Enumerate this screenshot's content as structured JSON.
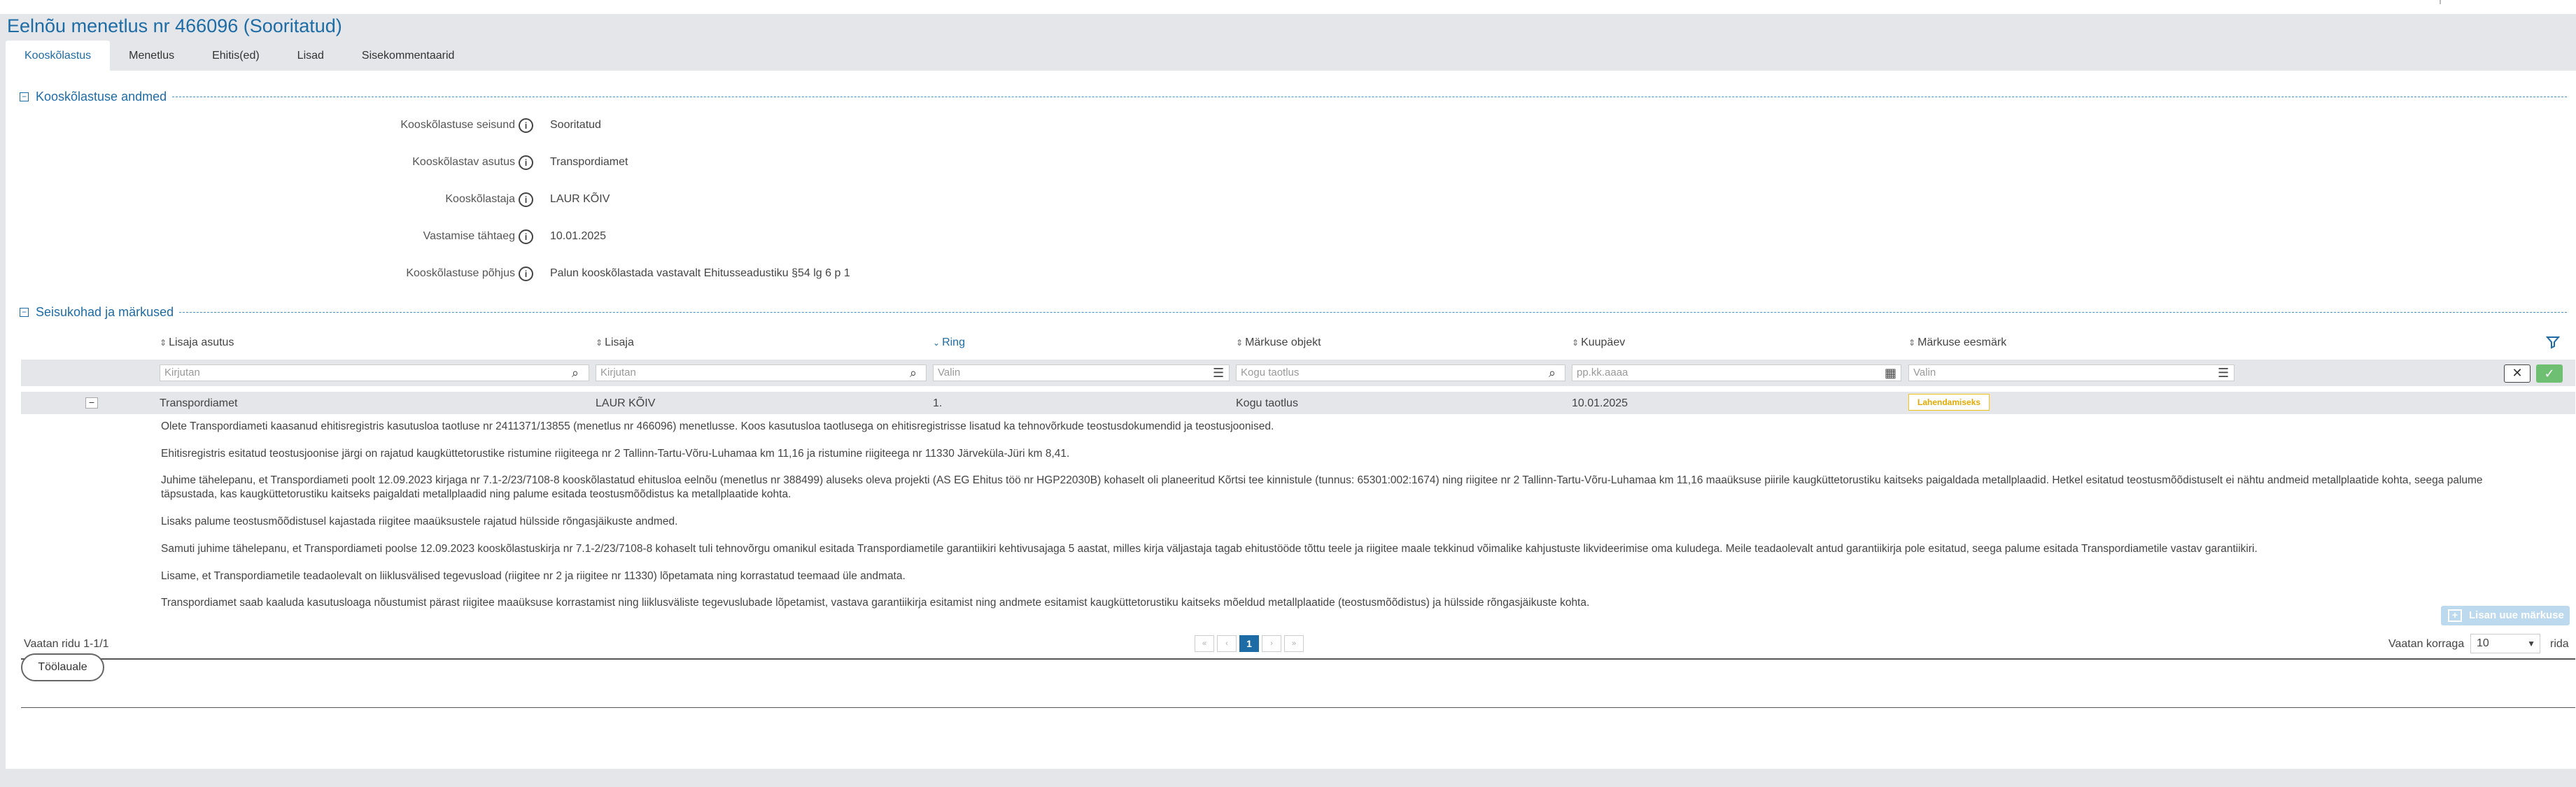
{
  "page": {
    "title": "Eelnõu menetlus nr 466096 (Sooritatud)"
  },
  "tabs": [
    {
      "label": "Kooskõlastus",
      "active": true
    },
    {
      "label": "Menetlus"
    },
    {
      "label": "Ehitis(ed)"
    },
    {
      "label": "Lisad"
    },
    {
      "label": "Sisekommentaarid"
    }
  ],
  "section1": {
    "title": "Kooskõlastuse andmed",
    "fields": [
      {
        "label": "Kooskõlastuse seisund",
        "value": "Sooritatud"
      },
      {
        "label": "Kooskõlastav asutus",
        "value": "Transpordiamet"
      },
      {
        "label": "Kooskõlastaja",
        "value": "LAUR KÕIV"
      },
      {
        "label": "Vastamise tähtaeg",
        "value": "10.01.2025"
      },
      {
        "label": "Kooskõlastuse põhjus",
        "value": "Palun kooskõlastada vastavalt Ehitusseadustiku §54 lg 6 p 1"
      }
    ]
  },
  "section2": {
    "title": "Seisukohad ja märkused",
    "columns": [
      "Lisaja asutus",
      "Lisaja",
      "Ring",
      "Märkuse objekt",
      "Kuupäev",
      "Märkuse eesmärk"
    ],
    "filters": {
      "lisaja_asutus": "Kirjutan",
      "lisaja": "Kirjutan",
      "ring": "Valin",
      "objekt": "Kogu taotlus",
      "kuupaev": "pp.kk.aaaa",
      "eesmark": "Valin"
    },
    "row": {
      "asutus": "Transpordiamet",
      "lisaja": "LAUR KÕIV",
      "ring": "1.",
      "objekt": "Kogu taotlus",
      "kuupaev": "10.01.2025",
      "eesmark": "Lahendamiseks"
    },
    "remarks": [
      "Olete Transpordiameti kaasanud ehitisregistris kasutusloa taotluse nr 2411371/13855 (menetlus nr 466096) menetlusse. Koos kasutusloa taotlusega on ehitisregistrisse lisatud ka tehnovõrkude teostusdokumendid ja teostusjoonised.",
      "Ehitisregistris esitatud teostusjoonise järgi on rajatud kaugküttetorustike ristumine riigiteega nr 2 Tallinn-Tartu-Võru-Luhamaa km 11,16 ja ristumine riigiteega nr 11330 Järveküla-Jüri km 8,41.",
      "Juhime tähelepanu, et Transpordiameti poolt 12.09.2023 kirjaga nr 7.1-2/23/7108-8 kooskõlastatud ehitusloa eelnõu (menetlus nr 388499) aluseks oleva projekti (AS EG Ehitus töö nr HGP22030B) kohaselt oli planeeritud Kõrtsi tee kinnistule (tunnus: 65301:002:1674) ning riigitee nr 2 Tallinn-Tartu-Võru-Luhamaa km 11,16 maaüksuse piirile kaugküttetorustiku kaitseks paigaldada metallplaadid. Hetkel esitatud teostusmõõdistuselt ei nähtu andmeid metallplaatide kohta, seega palume täpsustada, kas kaugküttetorustiku kaitseks paigaldati metallplaadid ning palume esitada teostusmõõdistus ka metallplaatide kohta.",
      "Lisaks palume teostusmõõdistusel kajastada riigitee maaüksustele rajatud hülsside rõngasjäikuste andmed.",
      "Samuti juhime tähelepanu, et Transpordiameti poolse 12.09.2023 kooskõlastuskirja nr 7.1-2/23/7108-8 kohaselt tuli tehnovõrgu omanikul esitada Transpordiametile garantiikiri kehtivusajaga 5 aastat, milles kirja väljastaja tagab ehitustööde tõttu teele ja riigitee maale tekkinud võimalike kahjustuste likvideerimise oma kuludega. Meile teadaolevalt antud garantiikirja pole esitatud, seega palume esitada Transpordiametile vastav garantiikiri.",
      "Lisame, et Transpordiametile teadaolevalt on liiklusvälised tegevusload (riigitee nr 2 ja riigitee nr 11330) lõpetamata ning korrastatud teemaad üle andmata.",
      "Transpordiamet saab kaaluda kasutusloaga nõustumist pärast riigitee maaüksuse korrastamist ning liiklusväliste tegevuslubade lõpetamist, vastava garantiikirja esitamist ning andmete esitamist kaugküttetorustiku kaitseks mõeldud metallplaatide (teostusmõõdistus) ja hülsside rõngasjäikuste kohta."
    ],
    "footer": {
      "rows_text": "Vaatan ridu 1-1/1",
      "pager": {
        "first": "«",
        "prev": "‹",
        "current": "1",
        "next": "›",
        "last": "»"
      },
      "pagesize_label": "Vaatan korraga",
      "pagesize_value": "10",
      "pagesize_suffix": "rida"
    },
    "add_button": "Lisan uue märkuse"
  },
  "back_button": "Töölauale",
  "colors": {
    "accent": "#1e6ca6",
    "badge": "#f0c419",
    "ok": "#6fbf73"
  }
}
